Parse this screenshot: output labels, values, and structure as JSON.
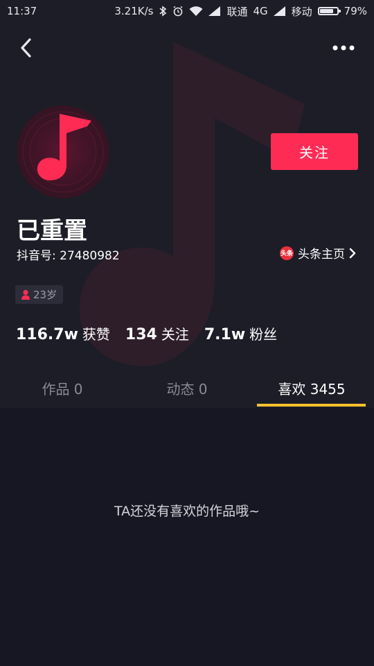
{
  "status_bar": {
    "time": "11:37",
    "speed": "3.21K/s",
    "carrier1": "联通",
    "network": "4G",
    "carrier2": "移动",
    "battery": "79%",
    "battery_level": 0.79,
    "icons": [
      "bluetooth-icon",
      "alarm-icon",
      "wifi-icon",
      "signal-icon",
      "signal-icon",
      "battery-icon"
    ]
  },
  "nav": {
    "back_icon": "chevron-left-icon",
    "more_icon": "more-dots-icon"
  },
  "profile": {
    "avatar_icon": "music-note-icon",
    "follow_label": "关注",
    "nickname": "已重置",
    "douyin_id": "抖音号: 27480982",
    "toutiao_logo_text": "头条",
    "toutiao_label": "头条主页",
    "age": "23岁"
  },
  "stats": [
    {
      "num": "116.7w",
      "label": "获赞"
    },
    {
      "num": "134",
      "label": "关注"
    },
    {
      "num": "7.1w",
      "label": "粉丝"
    }
  ],
  "tabs": [
    {
      "label": "作品 0"
    },
    {
      "label": "动态 0"
    },
    {
      "label": "喜欢 3455"
    }
  ],
  "active_tab": 2,
  "empty_message": "TA还没有喜欢的作品哦~",
  "colors": {
    "accent": "#fe2c55",
    "tab_indicator": "#f9c22d",
    "background": "#161722"
  }
}
